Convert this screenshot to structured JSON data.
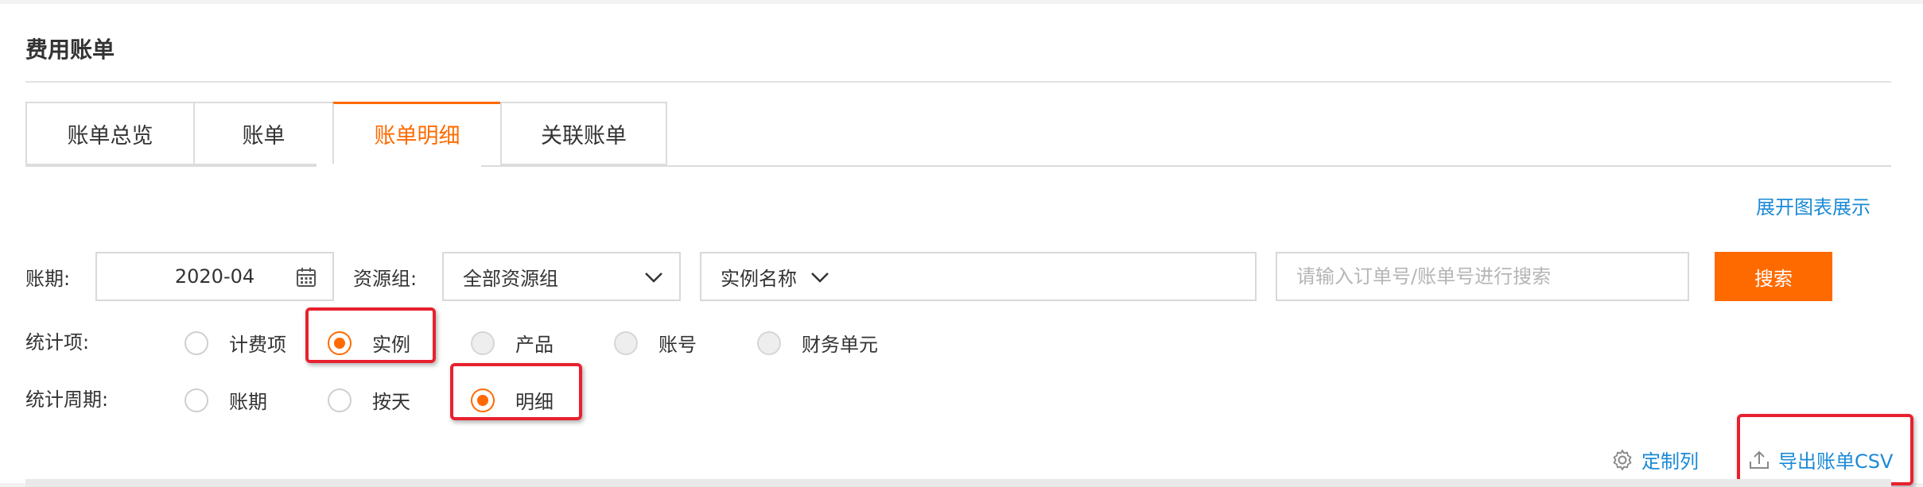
{
  "header": {
    "title": "费用账单"
  },
  "tabs": [
    {
      "label": "账单总览"
    },
    {
      "label": "账单"
    },
    {
      "label": "账单明细"
    },
    {
      "label": "关联账单"
    }
  ],
  "active_tab": "账单明细",
  "expand_chart_link": "展开图表展示",
  "filters": {
    "period_label": "账期:",
    "period_value": "2020-04",
    "resource_group_label": "资源组:",
    "resource_group_value": "全部资源组",
    "instance_dropdown_value": "实例名称",
    "search_placeholder": "请输入订单号/账单号进行搜索",
    "search_button": "搜索"
  },
  "stat_item": {
    "label": "统计项:",
    "options": [
      "计费项",
      "实例",
      "产品",
      "账号",
      "财务单元"
    ],
    "selected": "实例"
  },
  "stat_period": {
    "label": "统计周期:",
    "options": [
      "账期",
      "按天",
      "明细"
    ],
    "selected": "明细"
  },
  "toolbar": {
    "custom_columns": "定制列",
    "export_csv": "导出账单CSV"
  },
  "colors": {
    "accent": "#ff6a00",
    "link": "#1a8ad6",
    "highlight": "#e8212e"
  }
}
